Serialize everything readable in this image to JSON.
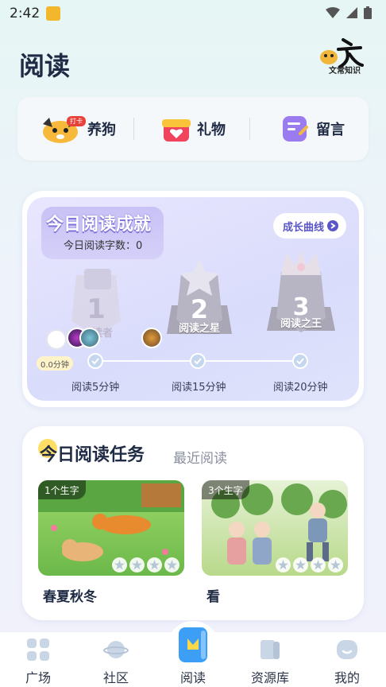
{
  "status_bar": {
    "time": "2:42"
  },
  "header": {
    "title": "阅读",
    "logo_caption": "文常知识"
  },
  "quick_actions": [
    {
      "label": "养狗",
      "badge": "打卡"
    },
    {
      "label": "礼物"
    },
    {
      "label": "留言"
    }
  ],
  "achievement": {
    "title": "今日阅读成就",
    "word_count": "今日阅读字数：0",
    "growth_button": "成长曲线",
    "badges": [
      {
        "number": "1",
        "label": "读者"
      },
      {
        "number": "2",
        "label": "阅读之星"
      },
      {
        "number": "3",
        "label": "阅读之王"
      }
    ],
    "progress_value": "0.0分钟",
    "milestones": [
      {
        "label": "阅读5分钟"
      },
      {
        "label": "阅读15分钟"
      },
      {
        "label": "阅读20分钟"
      }
    ]
  },
  "tasks": {
    "tab_active": "今日阅读任务",
    "tab_inactive": "最近阅读",
    "books": [
      {
        "badge": "1个生字",
        "title": "春夏秋冬"
      },
      {
        "badge": "3个生字",
        "title": "看"
      }
    ]
  },
  "bottom_nav": [
    {
      "label": "广场"
    },
    {
      "label": "社区"
    },
    {
      "label": "阅读"
    },
    {
      "label": "资源库"
    },
    {
      "label": "我的"
    }
  ]
}
